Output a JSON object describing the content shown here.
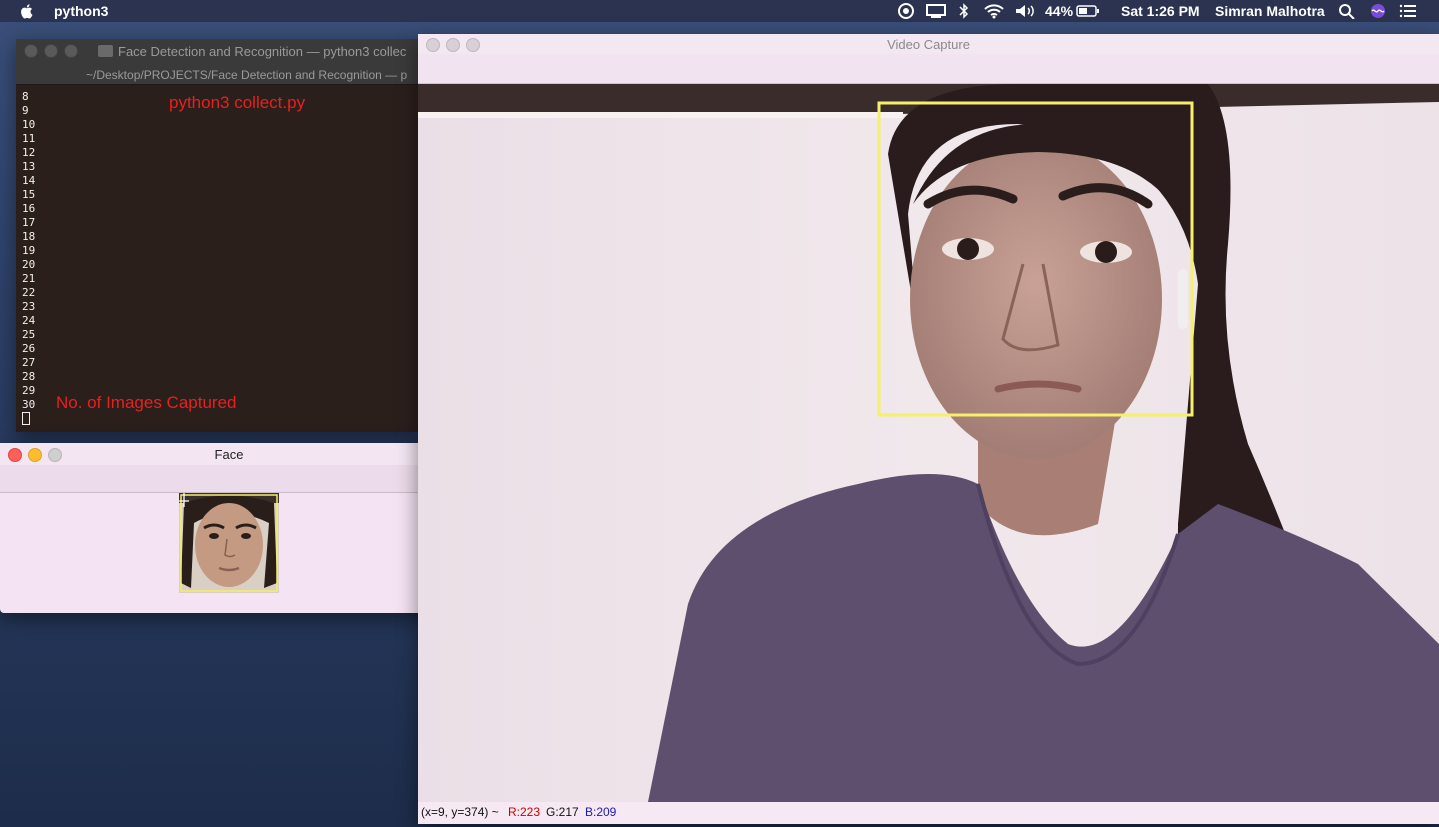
{
  "menubar": {
    "app_name": "python3",
    "battery": "44%",
    "clock": "Sat 1:26 PM",
    "user": "Simran Malhotra"
  },
  "terminal": {
    "title": "Face Detection and Recognition — python3 collec",
    "path": "~/Desktop/PROJECTS/Face Detection and Recognition — p",
    "lines": [
      "8",
      "9",
      "10",
      "11",
      "12",
      "13",
      "14",
      "15",
      "16",
      "17",
      "18",
      "19",
      "20",
      "21",
      "22",
      "23",
      "24",
      "25",
      "26",
      "27",
      "28",
      "29",
      "30"
    ],
    "annotation_top": "python3 collect.py",
    "annotation_bottom": "No. of Images Captured"
  },
  "video_window": {
    "title": "Video Capture",
    "status": {
      "coords": "(x=9, y=374) ~",
      "r": "R:223",
      "g": "G:217",
      "b": "B:209"
    }
  },
  "face_window": {
    "title": "Face"
  },
  "colors": {
    "annotation": "#e8201e",
    "detection_box": "#f5ef6a",
    "status_r": "#cc0000",
    "status_g": "#111111",
    "status_b": "#1a1ab0"
  }
}
